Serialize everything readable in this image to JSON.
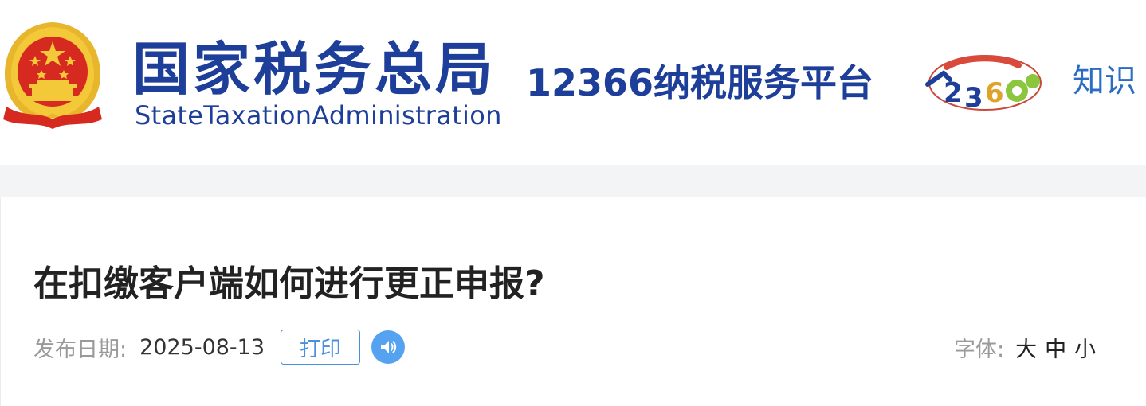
{
  "header": {
    "brand_cn": "国家税务总局",
    "brand_en": "StateTaxationAdministration",
    "platform": "12366纳税服务平台",
    "nav_link": "知识"
  },
  "article": {
    "title": "在扣缴客户端如何进行更正申报?",
    "date_label": "发布日期:",
    "date": "2025-08-13",
    "print_label": "打印",
    "audio_icon": "speaker-icon",
    "font_size_label": "字体:",
    "font_sizes": [
      "大",
      "中",
      "小"
    ]
  },
  "colors": {
    "brand_blue": "#1d3f9a",
    "link_blue": "#2b6cc4",
    "button_blue": "#4a8fdf",
    "emblem_red": "#d62a20",
    "emblem_gold": "#f2c230"
  }
}
